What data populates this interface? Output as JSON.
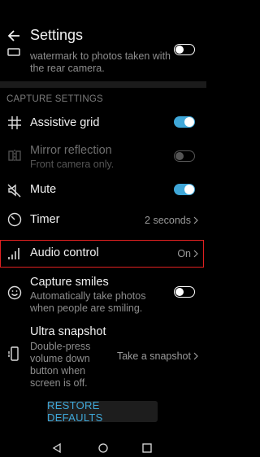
{
  "header": {
    "title": "Settings",
    "back_icon": "back-arrow-icon"
  },
  "watermark_row": {
    "description": "watermark to photos taken with the rear camera.",
    "toggle_on": false
  },
  "section_title": "CAPTURE SETTINGS",
  "rows": {
    "assistive_grid": {
      "label": "Assistive grid",
      "icon": "grid-icon",
      "toggle_on": true
    },
    "mirror_reflection": {
      "label": "Mirror reflection",
      "description": "Front camera only.",
      "icon": "mirror-icon",
      "toggle_on": false,
      "disabled": true
    },
    "mute": {
      "label": "Mute",
      "icon": "mute-icon",
      "toggle_on": true
    },
    "timer": {
      "label": "Timer",
      "value": "2 seconds",
      "icon": "timer-icon"
    },
    "audio_control": {
      "label": "Audio control",
      "value": "On",
      "icon": "audio-bars-icon"
    },
    "capture_smiles": {
      "label": "Capture smiles",
      "description": "Automatically take photos when people are smiling.",
      "icon": "smile-icon",
      "toggle_on": false
    },
    "ultra_snapshot": {
      "label": "Ultra snapshot",
      "description": "Double-press volume down button when screen is off.",
      "value": "Take a snapshot",
      "icon": "phone-snapshot-icon"
    }
  },
  "restore_button": "RESTORE DEFAULTS",
  "accent_color": "#3fa7d8",
  "highlight_color": "#e02020"
}
